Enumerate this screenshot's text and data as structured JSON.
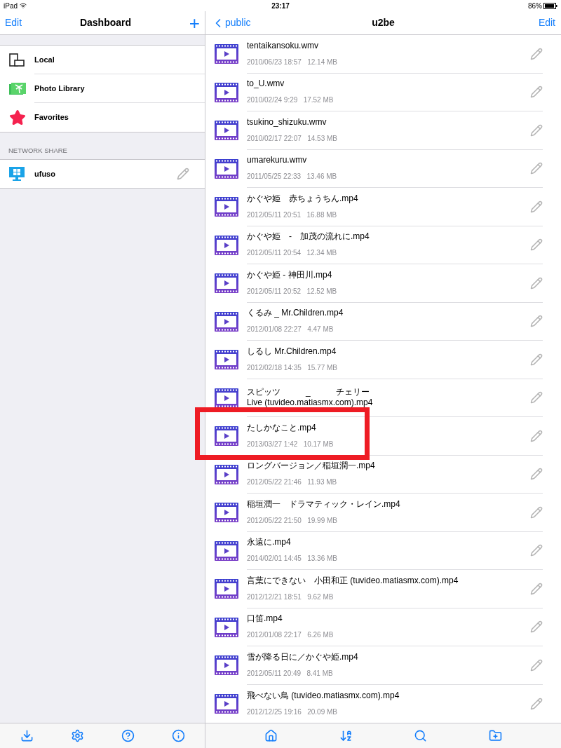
{
  "status_bar": {
    "device": "iPad",
    "time": "23:17",
    "battery": "86%"
  },
  "sidebar": {
    "edit": "Edit",
    "title": "Dashboard",
    "add": "+",
    "items": [
      {
        "kind": "local",
        "label": "Local"
      },
      {
        "kind": "photos",
        "label": "Photo Library"
      },
      {
        "kind": "favorites",
        "label": "Favorites"
      }
    ],
    "section": "NETWORK SHARE",
    "shares": [
      {
        "kind": "windows",
        "label": "ufuso"
      }
    ]
  },
  "content": {
    "back": "public",
    "title": "u2be",
    "edit": "Edit",
    "files": [
      {
        "name": "tentaikansoku.wmv",
        "meta": "2010/06/23 18:57   12.14 MB",
        "highlighted": false
      },
      {
        "name": "to_U.wmv",
        "meta": "2010/02/24 9:29   17.52 MB",
        "highlighted": false
      },
      {
        "name": "tsukino_shizuku.wmv",
        "meta": "2010/02/17 22:07   14.53 MB",
        "highlighted": false
      },
      {
        "name": "umarekuru.wmv",
        "meta": "2011/05/25 22:33   13.46 MB",
        "highlighted": false
      },
      {
        "name": "かぐや姫　赤ちょうちん.mp4",
        "meta": "2012/05/11 20:51   16.88 MB",
        "highlighted": false
      },
      {
        "name": "かぐや姫　-　加茂の流れに.mp4",
        "meta": "2012/05/11 20:54   12.34 MB",
        "highlighted": false
      },
      {
        "name": "かぐや姫 - 神田川.mp4",
        "meta": "2012/05/11 20:52   12.52 MB",
        "highlighted": false
      },
      {
        "name": "くるみ _ Mr.Children.mp4",
        "meta": "2012/01/08 22:27   4.47 MB",
        "highlighted": false
      },
      {
        "name": "しるし Mr.Children.mp4",
        "meta": "2012/02/18 14:35   15.77 MB",
        "highlighted": false
      },
      {
        "name": "スピッツ　　　_　　　チェリー　　　　　　　　　　　Live (tuvideo.matiasmx.com).mp4",
        "highlighted": false
      },
      {
        "name": "たしかなこと.mp4",
        "meta": "2013/03/27 1:42   10.17 MB",
        "highlighted": true
      },
      {
        "name": "ロングバージョン／稲垣潤一.mp4",
        "meta": "2012/05/22 21:46   11.93 MB",
        "highlighted": false
      },
      {
        "name": "稲垣潤一　ドラマティック・レイン.mp4",
        "meta": "2012/05/22 21:50   19.99 MB",
        "highlighted": false
      },
      {
        "name": "永遠に.mp4",
        "meta": "2014/02/01 14:45   13.36 MB",
        "highlighted": false
      },
      {
        "name": "言葉にできない　小田和正 (tuvideo.matiasmx.com).mp4",
        "meta": "2012/12/21 18:51   9.62 MB",
        "highlighted": false
      },
      {
        "name": "口笛.mp4",
        "meta": "2012/01/08 22:17   6.26 MB",
        "highlighted": false
      },
      {
        "name": "雪が降る日に／かぐや姫.mp4",
        "meta": "2012/05/11 20:49   8.41 MB",
        "highlighted": false
      },
      {
        "name": "飛べない鳥 (tuvideo.matiasmx.com).mp4",
        "meta": "2012/12/25 19:16   20.09 MB",
        "highlighted": false
      }
    ]
  }
}
